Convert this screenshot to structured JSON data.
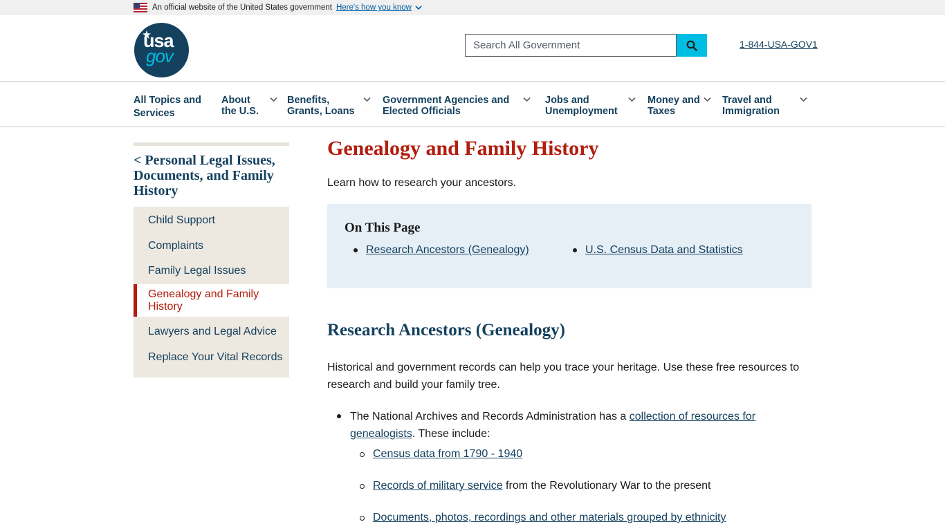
{
  "banner": {
    "official_text": "An official website of the United States government",
    "how_link": "Here's how you know"
  },
  "header": {
    "logo_usa": "usa",
    "logo_gov": "gov",
    "search_placeholder": "Search All Government",
    "phone": "1-844-USA-GOV1"
  },
  "nav": {
    "items": [
      {
        "line1": "All Topics and",
        "line2": "Services"
      },
      {
        "line1": "About",
        "line2": "the U.S."
      },
      {
        "line1": "Benefits,",
        "line2": "Grants, Loans"
      },
      {
        "line1": "Government Agencies and",
        "line2": "Elected Officials"
      },
      {
        "line1": "Jobs and",
        "line2": "Unemployment"
      },
      {
        "line1": "Money and",
        "line2": "Taxes"
      },
      {
        "line1": "Travel and",
        "line2": "Immigration"
      }
    ]
  },
  "sidebar": {
    "back_label": "< Personal Legal Issues, Documents, and Family History",
    "items": [
      {
        "label": "Child Support"
      },
      {
        "label": "Complaints"
      },
      {
        "label": "Family Legal Issues"
      },
      {
        "label": "Genealogy and Family History"
      },
      {
        "label": "Lawyers and Legal Advice"
      },
      {
        "label": "Replace Your Vital Records"
      }
    ]
  },
  "main": {
    "title": "Genealogy and Family History",
    "lead": "Learn how to research your ancestors.",
    "on_this_page": {
      "title": "On This Page",
      "links": [
        "Research Ancestors (Genealogy)",
        "U.S. Census Data and Statistics"
      ]
    },
    "section_title": "Research Ancestors (Genealogy)",
    "paragraph": "Historical and government records can help you trace your heritage. Use these free resources to research and build your family tree.",
    "bullet1": {
      "prefix": "The National Archives and Records Administration has a ",
      "link": "collection of resources for genealogists",
      "suffix": ". These include:"
    },
    "subitems": [
      {
        "link": "Census data from 1790 - 1940",
        "suffix": ""
      },
      {
        "link": "Records of military service",
        "suffix": " from the Revolutionary War to the present"
      },
      {
        "link": "Documents, photos, recordings and other materials grouped by ethnicity",
        "suffix": ""
      }
    ]
  },
  "colors": {
    "navy": "#14415e",
    "red_accent": "#b21d0d",
    "cyan": "#00bde3",
    "panel_blue": "#e6eef6",
    "sidebar_tan": "#ede8e0"
  }
}
